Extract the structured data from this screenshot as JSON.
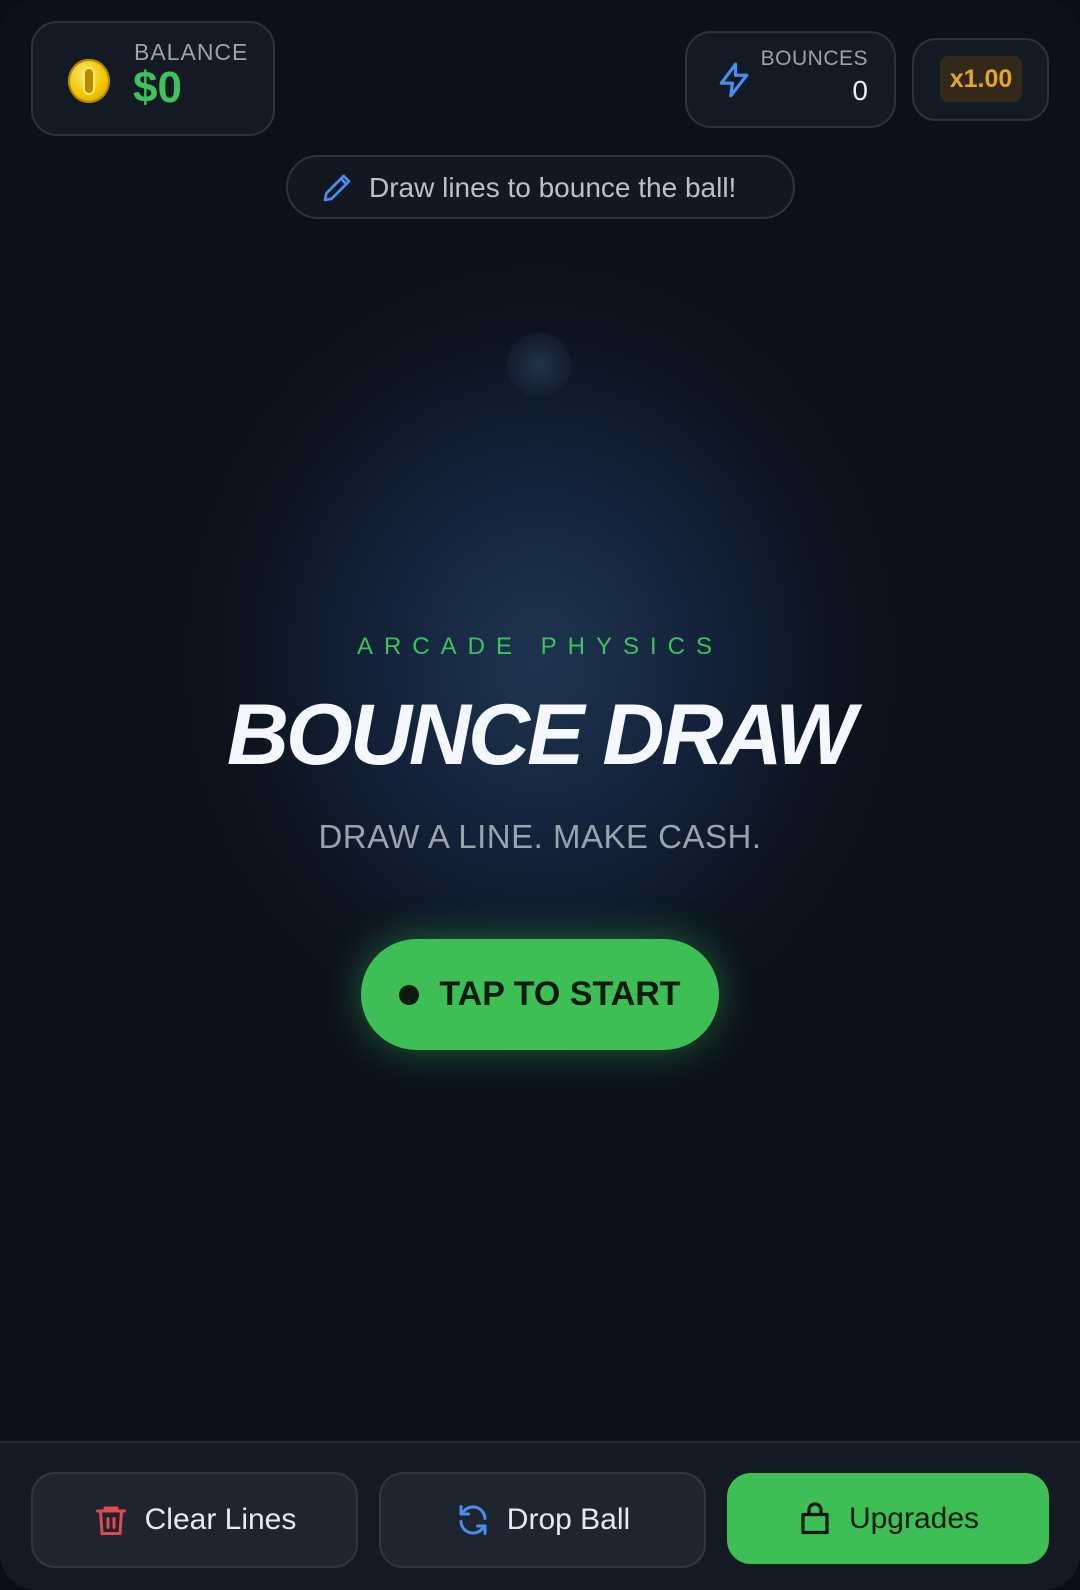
{
  "hud": {
    "balance_label": "BALANCE",
    "balance_value": "$0",
    "bounces_label": "BOUNCES",
    "bounces_value": "0",
    "multiplier": "x1.00"
  },
  "hint": {
    "text": "Draw lines to bounce the ball!"
  },
  "splash": {
    "kicker": "ARCADE PHYSICS",
    "title": "BOUNCE DRAW",
    "tagline": "DRAW A LINE. MAKE CASH.",
    "start_label": "TAP TO START"
  },
  "toolbar": {
    "clear_label": "Clear Lines",
    "drop_label": "Drop Ball",
    "upgrades_label": "Upgrades"
  },
  "colors": {
    "accent_green": "#3ebf56",
    "multiplier_gold": "#e3a52a",
    "icon_blue": "#4a8ef0",
    "trash_red": "#e5484d"
  },
  "icons": {
    "balance": "coin-icon",
    "bounces": "lightning-bolt-icon",
    "hint": "pencil-icon",
    "clear": "trash-icon",
    "drop": "refresh-icon",
    "upgrades": "shopping-bag-icon"
  }
}
